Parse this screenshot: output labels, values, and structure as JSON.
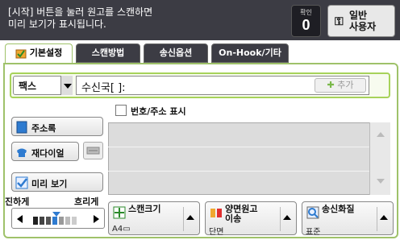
{
  "header": {
    "message_line1": "[시작] 버튼을 눌러 원고를 스캔하면",
    "message_line2": "미리 보기가 표시됩니다.",
    "confirm_label": "확인",
    "confirm_count": "0",
    "user_label_line1": "일반",
    "user_label_line2": "사용자"
  },
  "tabs": [
    {
      "label": "기본설정",
      "active": true
    },
    {
      "label": "스캔방법",
      "active": false
    },
    {
      "label": "송신옵션",
      "active": false
    },
    {
      "label": "On-Hook/기타",
      "active": false
    }
  ],
  "recipient": {
    "type_select": "팩스",
    "field_text": "수신국[    ]:",
    "add_button": "추가"
  },
  "show_number_checkbox": "번호/주소 표시",
  "sidebar": {
    "address_book": "주소록",
    "redial": "재다이얼",
    "preview": "미리 보기"
  },
  "speed": {
    "left_label": "진하게",
    "right_label": "흐리게"
  },
  "options": {
    "scan_size": {
      "title": "스캔크기",
      "value": "A4▭"
    },
    "duplex": {
      "title_line1": "양면원고",
      "title_line2": "이송",
      "value": "단면"
    },
    "send_quality": {
      "title": "송신화질",
      "value": "표준"
    }
  },
  "colors": {
    "accent_green": "#9fc26a",
    "header_bg": "#3c3c44"
  }
}
